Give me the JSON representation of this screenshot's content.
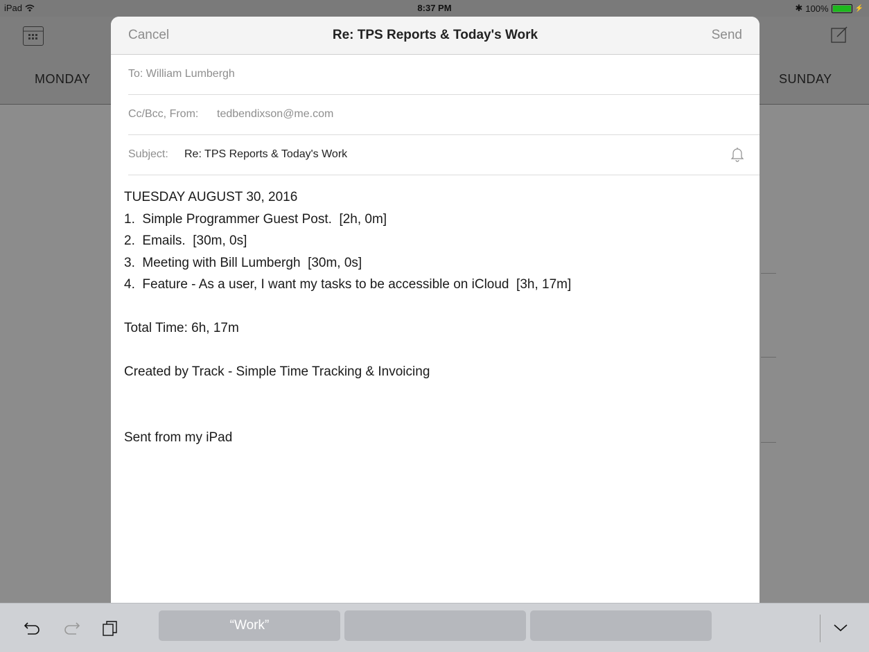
{
  "status_bar": {
    "device": "iPad",
    "time": "8:37 PM",
    "battery": "100%",
    "battery_level": 1.0,
    "battery_color": "#1db81d"
  },
  "background": {
    "day_left": "MONDAY",
    "day_right": "SUNDAY"
  },
  "compose": {
    "cancel_label": "Cancel",
    "title": "Re: TPS Reports & Today's Work",
    "send_label": "Send",
    "to_field": "To: William Lumbergh",
    "cc_label": "Cc/Bcc, From:",
    "from_value": "tedbendixson@me.com",
    "subject_label": "Subject:",
    "subject_value": "Re: TPS Reports & Today's Work",
    "body_lines": [
      "TUESDAY AUGUST 30, 2016",
      "1.  Simple Programmer Guest Post.  [2h, 0m]",
      "2.  Emails.  [30m, 0s]",
      "3.  Meeting with Bill Lumbergh  [30m, 0s]",
      "4.  Feature - As a user, I want my tasks to be accessible on iCloud  [3h, 17m]",
      "",
      "Total Time: 6h, 17m",
      "",
      "Created by Track - Simple Time Tracking & Invoicing",
      "",
      "",
      "Sent from my iPad"
    ]
  },
  "keyboard": {
    "suggestions": [
      "“Work”",
      "",
      ""
    ]
  },
  "icons": [
    "wifi-icon",
    "bluetooth-icon",
    "battery-icon",
    "calendar-icon",
    "compose-icon",
    "bell-icon",
    "undo-icon",
    "redo-icon",
    "paste-icon",
    "chevron-down-icon"
  ]
}
